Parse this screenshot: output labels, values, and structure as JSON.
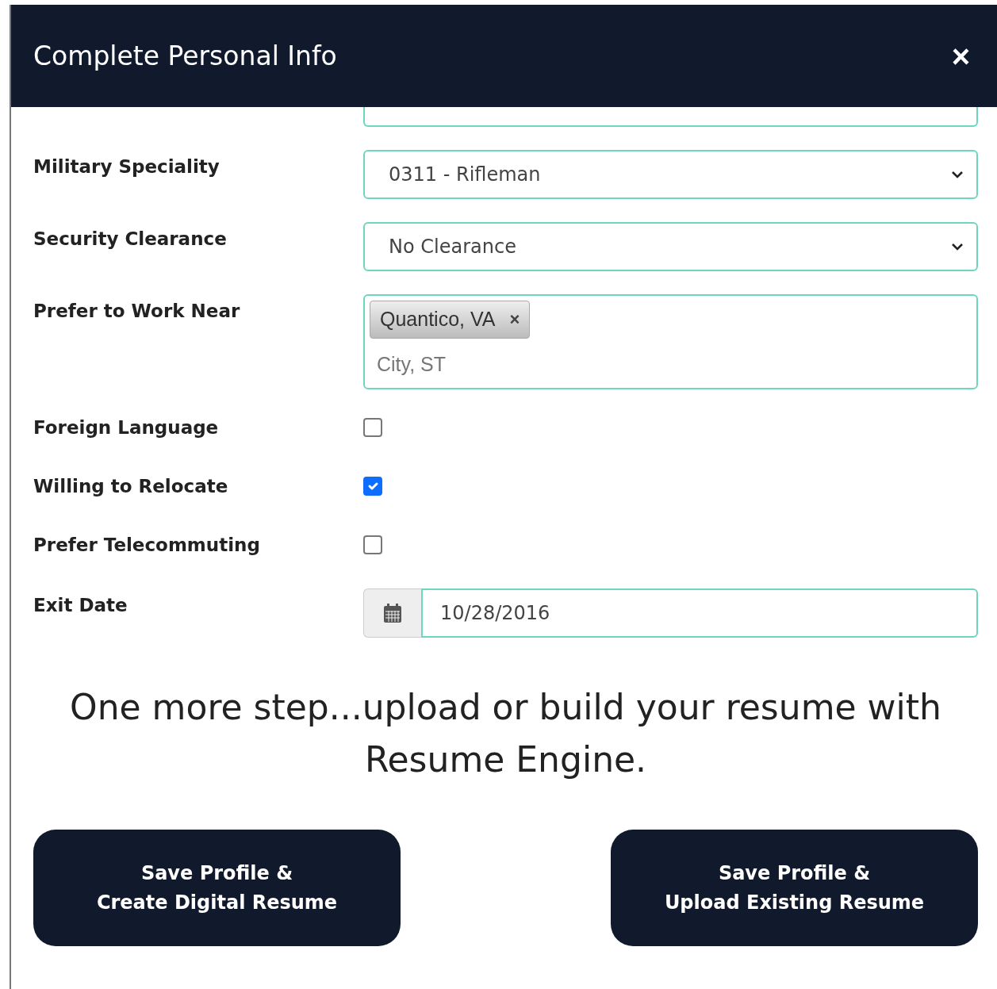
{
  "modal": {
    "title": "Complete Personal Info",
    "close": "×"
  },
  "fields": [
    {
      "kind": "select",
      "label": "Military Speciality",
      "value": "0311 - Rifleman"
    },
    {
      "kind": "select",
      "label": "Security Clearance",
      "value": "No Clearance"
    },
    {
      "kind": "tags",
      "label": "Prefer to Work Near",
      "tags": [
        {
          "text": "Quantico, VA",
          "remove": "×"
        }
      ],
      "placeholder": "City, ST"
    },
    {
      "kind": "checkbox",
      "label": "Foreign Language",
      "checked": false
    },
    {
      "kind": "checkbox",
      "label": "Willing to Relocate",
      "checked": true
    },
    {
      "kind": "checkbox",
      "label": "Prefer Telecommuting",
      "checked": false
    },
    {
      "kind": "date",
      "label": "Exit Date",
      "value": "10/28/2016"
    }
  ],
  "prompt": "One more step...upload or build your resume with Resume Engine.",
  "buttons": [
    {
      "lines": [
        "Save Profile &",
        "Create Digital Resume"
      ]
    },
    {
      "lines": [
        "Save Profile &",
        "Upload Existing Resume"
      ]
    }
  ]
}
